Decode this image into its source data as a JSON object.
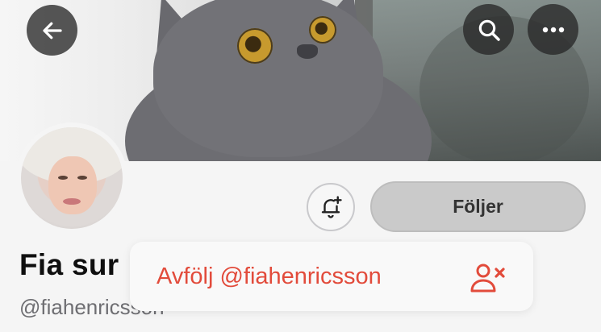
{
  "header": {
    "back_icon": "arrow-left-icon",
    "search_icon": "search-icon",
    "more_icon": "ellipsis-icon"
  },
  "profile": {
    "display_name": "Fia sur",
    "handle": "@fiahenricsson",
    "follow_button_label": "Följer",
    "bell_icon": "bell-plus-icon"
  },
  "menu": {
    "items": [
      {
        "label": "Avfölj @fiahenricsson",
        "icon": "user-remove-icon",
        "color": "#e24b3b"
      }
    ]
  },
  "colors": {
    "destructive": "#e24b3b",
    "follow_button_bg": "#cacaca",
    "overlay_button_bg": "#282828"
  }
}
